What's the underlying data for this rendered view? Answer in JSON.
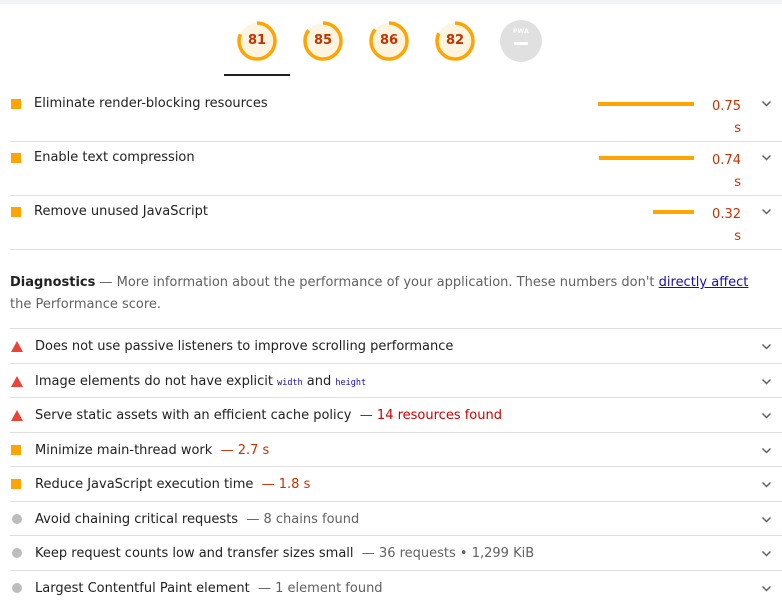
{
  "gauges": [
    {
      "score": "81",
      "color": "#ffa400",
      "fraction": 0.81
    },
    {
      "score": "85",
      "color": "#ffa400",
      "fraction": 0.85
    },
    {
      "score": "86",
      "color": "#ffa400",
      "fraction": 0.86
    },
    {
      "score": "82",
      "color": "#ffa400",
      "fraction": 0.82
    }
  ],
  "pwa": {
    "label": "PWA"
  },
  "opportunities": [
    {
      "title": "Eliminate render-blocking resources",
      "value": "0.75 s",
      "bar_fraction": 0.75
    },
    {
      "title": "Enable text compression",
      "value": "0.74 s",
      "bar_fraction": 0.74
    },
    {
      "title": "Remove unused JavaScript",
      "value": "0.32 s",
      "bar_fraction": 0.32
    }
  ],
  "diagnostics": {
    "heading": "Diagnostics",
    "description_before": " — More information about the performance of your application. These numbers don't ",
    "link": "directly affect",
    "description_after": " the Performance score.",
    "items": [
      {
        "status": "fail",
        "title": "Does not use passive listeners to improve scrolling performance",
        "display": ""
      },
      {
        "status": "fail",
        "title_before": "Image elements do not have explicit ",
        "code1": "width",
        "title_mid": " and ",
        "code2": "height",
        "display": ""
      },
      {
        "status": "fail",
        "title": "Serve static assets with an efficient cache policy",
        "display": "14 resources found"
      },
      {
        "status": "average",
        "title": "Minimize main-thread work",
        "display": "2.7 s"
      },
      {
        "status": "average",
        "title": "Reduce JavaScript execution time",
        "display": "1.8 s"
      },
      {
        "status": "info",
        "title": "Avoid chaining critical requests",
        "display": "8 chains found"
      },
      {
        "status": "info",
        "title": "Keep request counts low and transfer sizes small",
        "display": "36 requests • 1,299 KiB"
      },
      {
        "status": "info",
        "title": "Largest Contentful Paint element",
        "display": "1 element found"
      }
    ]
  },
  "separator": "—",
  "colors": {
    "average": "#ffa400",
    "fail": "#eb4436",
    "info": "#bdbdbd",
    "average_text": "#c33300",
    "fail_text": "#cc0000"
  }
}
